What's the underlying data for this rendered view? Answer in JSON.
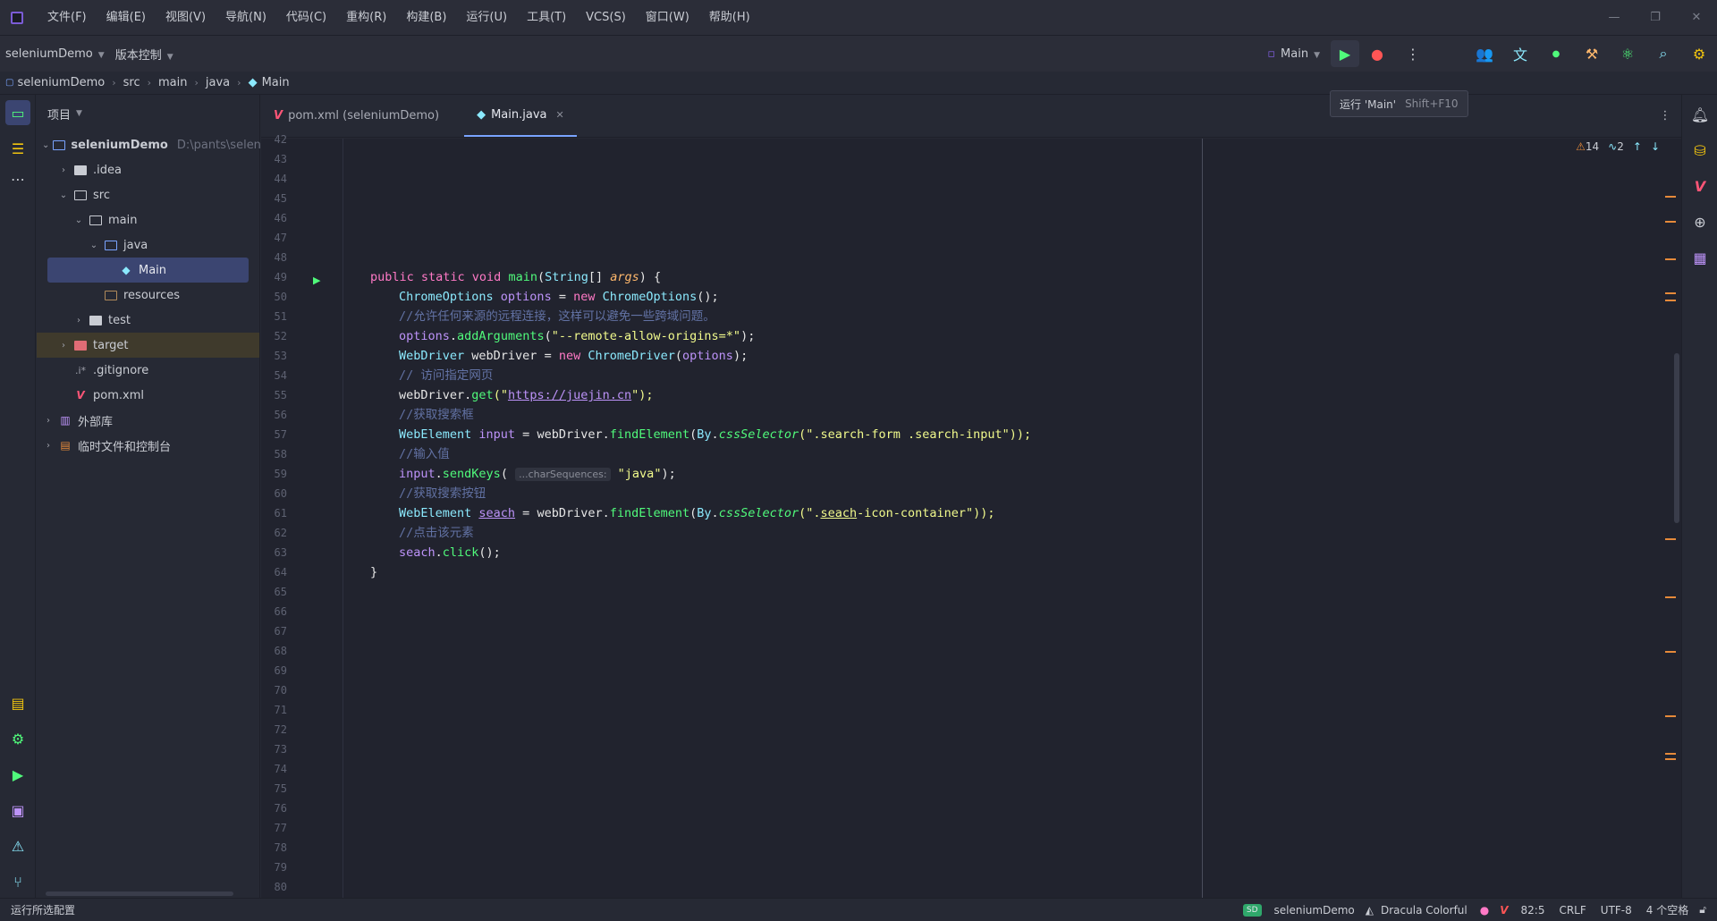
{
  "menu": {
    "items": [
      "文件(F)",
      "编辑(E)",
      "视图(V)",
      "导航(N)",
      "代码(C)",
      "重构(R)",
      "构建(B)",
      "运行(U)",
      "工具(T)",
      "VCS(S)",
      "窗口(W)",
      "帮助(H)"
    ]
  },
  "toolbar": {
    "project": "seleniumDemo",
    "vcs": "版本控制",
    "run_config": "Main"
  },
  "tooltip": {
    "text": "运行 'Main'",
    "shortcut": "Shift+F10"
  },
  "breadcrumb": [
    "seleniumDemo",
    "src",
    "main",
    "java",
    "Main"
  ],
  "project_panel": {
    "title": "项目",
    "root": "seleniumDemo",
    "root_path": "D:\\pants\\seleniun",
    "nodes": {
      "idea": ".idea",
      "src": "src",
      "main": "main",
      "java": "java",
      "Main": "Main",
      "resources": "resources",
      "test": "test",
      "target": "target",
      "gitignore": ".gitignore",
      "pom": "pom.xml",
      "external": "外部库",
      "scratches": "临时文件和控制台"
    }
  },
  "tabs": [
    {
      "label": "pom.xml (seleniumDemo)"
    },
    {
      "label": "Main.java"
    }
  ],
  "inspections": {
    "warnings": "14",
    "typos": "2"
  },
  "gutter": {
    "line_numbers": [
      "42",
      "43",
      "44",
      "45",
      "46",
      "47",
      "48",
      "49",
      "50",
      "51",
      "52",
      "53",
      "54",
      "55",
      "56",
      "57",
      "58",
      "59",
      "60",
      "61",
      "62",
      "63",
      "64",
      "65",
      "66",
      "67",
      "68",
      "69",
      "70",
      "71",
      "72",
      "73",
      "74",
      "75",
      "76",
      "77",
      "78",
      "79",
      "80"
    ]
  },
  "code": {
    "l49_a": "public static void ",
    "l49_b": "main",
    "l49_c": "(",
    "l49_d": "String",
    "l49_e": "[] ",
    "l49_f": "args",
    "l49_g": ") {",
    "l50_a": "ChromeOptions ",
    "l50_b": "options",
    "l50_c": " = ",
    "l50_d": "new ",
    "l50_e": "ChromeOptions",
    "l50_f": "();",
    "l51": "//允许任何来源的远程连接，这样可以避免一些跨域问题。",
    "l52_a": "options",
    "l52_b": ".",
    "l52_c": "addArguments",
    "l52_d": "(",
    "l52_e": "\"--remote-allow-origins=*\"",
    "l52_f": ");",
    "l53_a": "WebDriver ",
    "l53_b": "webDriver",
    "l53_c": " = ",
    "l53_d": "new ",
    "l53_e": "ChromeDriver",
    "l53_f": "(",
    "l53_g": "options",
    "l53_h": ");",
    "l54": "// 访问指定网页",
    "l55_a": "webDriver",
    "l55_b": ".",
    "l55_c": "get",
    "l55_d": "(\"",
    "l55_e": "https://juejin.cn",
    "l55_f": "\");",
    "l56": "//获取搜索框",
    "l57_a": "WebElement ",
    "l57_b": "input",
    "l57_c": " = ",
    "l57_d": "webDriver",
    "l57_e": ".",
    "l57_f": "findElement",
    "l57_g": "(",
    "l57_h": "By",
    "l57_i": ".",
    "l57_j": "cssSelector",
    "l57_k": "(\".search-form .search-input\"));",
    "l58": "//输入值",
    "l59_a": "input",
    "l59_b": ".",
    "l59_c": "sendKeys",
    "l59_d": "( ",
    "l59_hint": "...charSequences:",
    "l59_e": " \"java\"",
    "l59_f": ");",
    "l60": "//获取搜索按钮",
    "l61_a": "WebElement ",
    "l61_b": "seach",
    "l61_c": " = ",
    "l61_d": "webDriver",
    "l61_e": ".",
    "l61_f": "findElement",
    "l61_g": "(",
    "l61_h": "By",
    "l61_i": ".",
    "l61_j": "cssSelector",
    "l61_k": "(\".",
    "l61_l": "seach",
    "l61_m": "-icon-container\"));",
    "l62": "//点击该元素",
    "l63_a": "seach",
    "l63_b": ".",
    "l63_c": "click",
    "l63_d": "();",
    "l64": "}"
  },
  "statusbar": {
    "left": "运行所选配置",
    "project_badge": "SD",
    "project": "seleniumDemo",
    "theme": "Dracula Colorful",
    "position": "82:5",
    "line_sep": "CRLF",
    "encoding": "UTF-8",
    "indent": "4 个空格"
  },
  "colors": {
    "accent": "#7aa4ff",
    "run_green": "#50fa7b",
    "warning": "#e68a3a",
    "selection": "#3b4571"
  }
}
